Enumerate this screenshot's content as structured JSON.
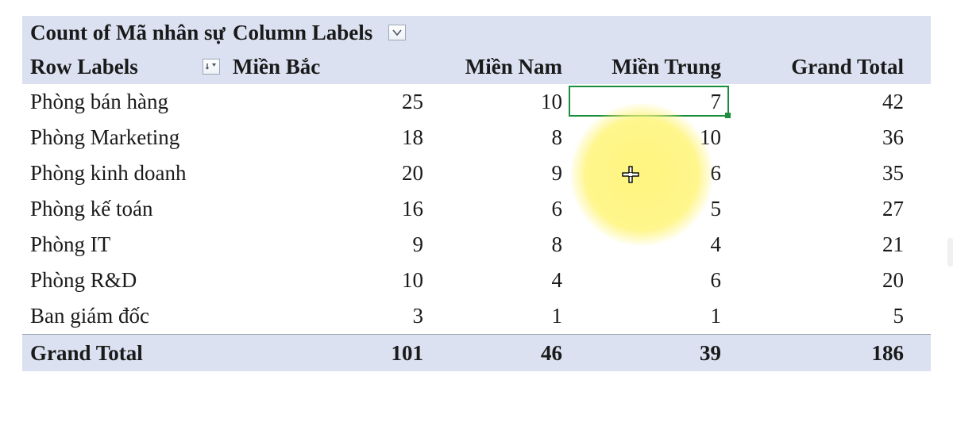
{
  "pivot": {
    "measure_label": "Count of Mã nhân sự",
    "column_labels_label": "Column Labels",
    "row_labels_label": "Row Labels",
    "columns": [
      "Miền Bắc",
      "Miền Nam",
      "Miền Trung",
      "Grand Total"
    ],
    "rows": [
      {
        "label": "Phòng bán hàng",
        "values": [
          25,
          10,
          7,
          42
        ]
      },
      {
        "label": "Phòng Marketing",
        "values": [
          18,
          8,
          10,
          36
        ]
      },
      {
        "label": "Phòng kinh doanh",
        "values": [
          20,
          9,
          6,
          35
        ]
      },
      {
        "label": "Phòng kế toán",
        "values": [
          16,
          6,
          5,
          27
        ]
      },
      {
        "label": "Phòng IT",
        "values": [
          9,
          8,
          4,
          21
        ]
      },
      {
        "label": "Phòng R&D",
        "values": [
          10,
          4,
          6,
          20
        ]
      },
      {
        "label": "Ban giám đốc",
        "values": [
          3,
          1,
          1,
          5
        ]
      }
    ],
    "grand_total_label": "Grand Total",
    "grand_total_values": [
      101,
      46,
      39,
      186
    ]
  },
  "selection": {
    "row": 0,
    "col": 2
  },
  "cursor_highlight": {
    "row": 2,
    "col": 2
  },
  "icons": {
    "chevron_down": "chevron-down-icon",
    "sort_dropdown": "sort-dropdown-icon",
    "plus_cursor": "excel-plus-cursor"
  },
  "colors": {
    "header_bg": "#dbe1f1",
    "selection_border": "#1b8e3d",
    "highlight": "#fff478"
  }
}
